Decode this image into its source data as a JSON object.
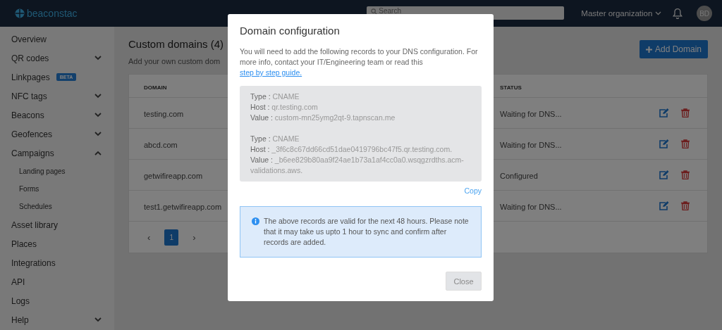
{
  "topbar": {
    "logo": "beaconstac",
    "search": {
      "placeholder": "Search"
    },
    "organization": "Master organization",
    "avatar": "BD"
  },
  "sidebar": {
    "items": [
      {
        "kind": "link",
        "label": "Overview"
      },
      {
        "kind": "group",
        "label": "QR codes",
        "expanded": false
      },
      {
        "kind": "link",
        "label": "Linkpages",
        "badge": "BETA"
      },
      {
        "kind": "group",
        "label": "NFC tags",
        "expanded": false
      },
      {
        "kind": "group",
        "label": "Beacons",
        "expanded": false
      },
      {
        "kind": "group",
        "label": "Geofences",
        "expanded": false
      },
      {
        "kind": "group",
        "label": "Campaigns",
        "expanded": true,
        "children": [
          {
            "label": "Landing pages"
          },
          {
            "label": "Forms"
          },
          {
            "label": "Schedules"
          }
        ]
      },
      {
        "kind": "link",
        "label": "Asset library"
      },
      {
        "kind": "link",
        "label": "Places"
      },
      {
        "kind": "link",
        "label": "Integrations"
      },
      {
        "kind": "link",
        "label": "API"
      },
      {
        "kind": "link",
        "label": "Logs"
      },
      {
        "kind": "group",
        "label": "Help",
        "expanded": false
      }
    ]
  },
  "page": {
    "title": "Custom domains (4)",
    "subtitle": "Add your own custom dom",
    "add_button": "Add Domain"
  },
  "table": {
    "columns": [
      "DOMAIN",
      "STATUS"
    ],
    "rows": [
      {
        "domain": "testing.com",
        "status": "Waiting for DNS..."
      },
      {
        "domain": "abcd.com",
        "status": "Waiting for DNS..."
      },
      {
        "domain": "getwifireapp.com",
        "status": "Configured"
      },
      {
        "domain": "test1.getwifireapp.com",
        "status": "Waiting for DNS..."
      }
    ],
    "pagination": {
      "prev": "‹",
      "pages": [
        {
          "label": "1",
          "selected": true
        }
      ],
      "next": "›"
    }
  },
  "modal": {
    "title": "Domain configuration",
    "intro": "You will need to add the following records to your DNS configuration. For more info, contact your IT/Engineering team or read this",
    "link": "step by step guide.",
    "records": [
      {
        "fields": [
          {
            "label": "Type :",
            "value": "CNAME"
          },
          {
            "label": "Host :",
            "value": "qr.testing.com"
          },
          {
            "label": "Value :",
            "value": "custom-mn25ymg2qt-9.tapnscan.me"
          }
        ]
      },
      {
        "fields": [
          {
            "label": "Type :",
            "value": "CNAME"
          },
          {
            "label": "Host :",
            "value": "_3f6c8c67dd66cd51dae0419796bc47f5.qr.testing.com."
          },
          {
            "label": "Value :",
            "value": "_b6ee829b80aa9f24ae1b73a1af4cc0a0.wsqgzrdths.acm-validations.aws."
          }
        ]
      }
    ],
    "copy": "Copy",
    "notice": "The above records are valid for the next 48 hours. Please note that it may take us upto 1 hour to sync and confirm after records are added.",
    "close": "Close"
  }
}
